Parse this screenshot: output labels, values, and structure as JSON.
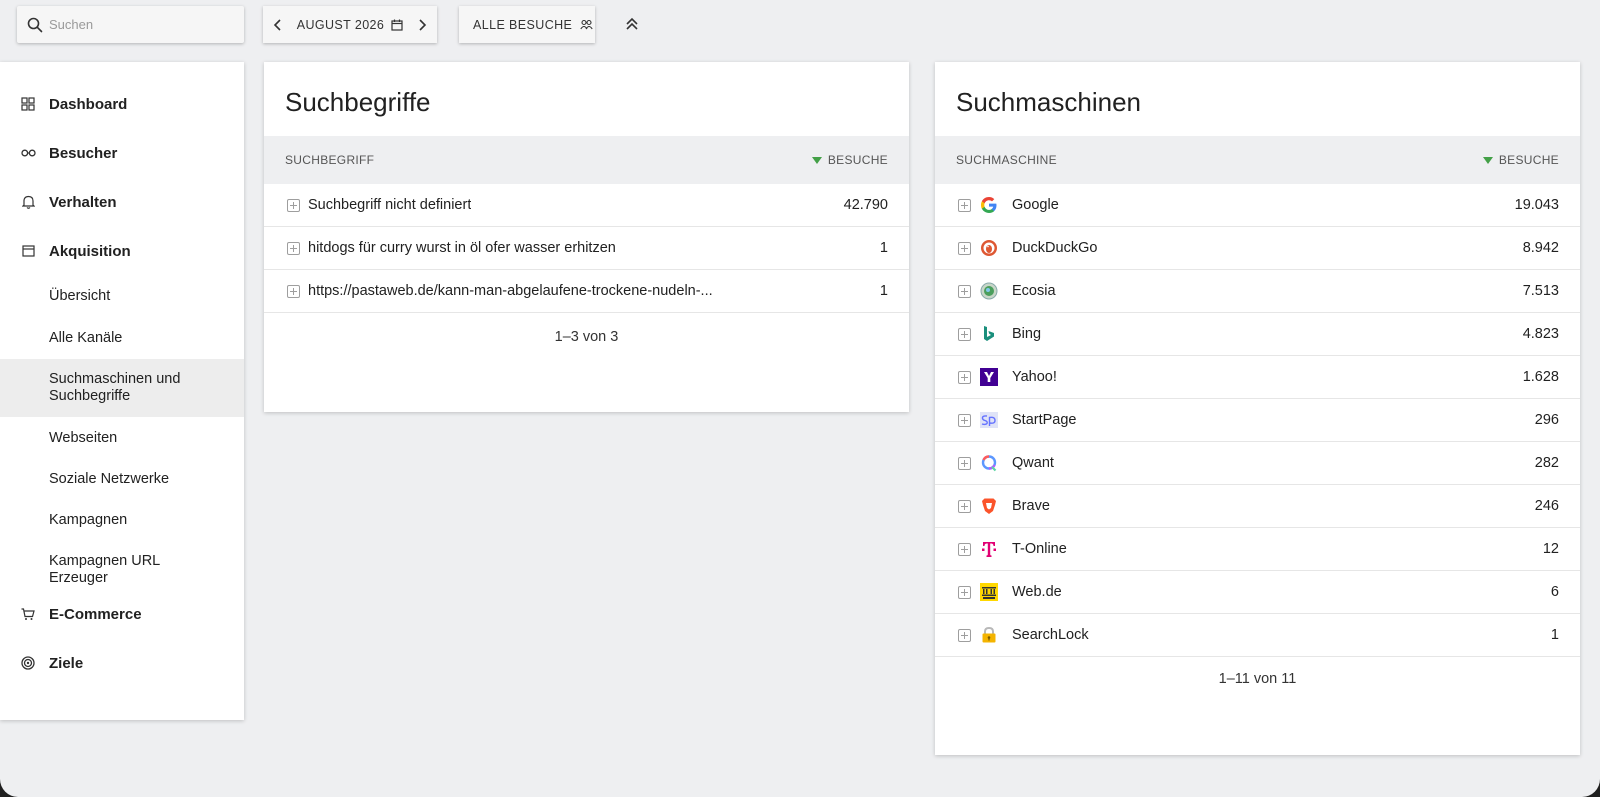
{
  "topbar": {
    "search_placeholder": "Suchen",
    "period_label": "AUGUST 2026",
    "segment_label": "ALLE BESUCHE"
  },
  "sidebar": {
    "categories": [
      {
        "label": "Dashboard",
        "icon": "dashboard-grid-icon"
      },
      {
        "label": "Besucher",
        "icon": "glasses-icon"
      },
      {
        "label": "Verhalten",
        "icon": "bell-icon"
      },
      {
        "label": "Akquisition",
        "icon": "window-icon"
      },
      {
        "label": "E-Commerce",
        "icon": "cart-icon"
      },
      {
        "label": "Ziele",
        "icon": "target-icon"
      }
    ],
    "acquisition_items": [
      {
        "label": "Übersicht"
      },
      {
        "label": "Alle Kanäle"
      },
      {
        "label": "Suchmaschinen und Suchbegriffe",
        "active": true
      },
      {
        "label": "Webseiten"
      },
      {
        "label": "Soziale Netzwerke"
      },
      {
        "label": "Kampagnen"
      },
      {
        "label": "Kampagnen URL Erzeuger"
      }
    ]
  },
  "keywords": {
    "title": "Suchbegriffe",
    "col_label": "SUCHBEGRIFF",
    "col_value": "BESUCHE",
    "rows": [
      {
        "label": "Suchbegriff nicht definiert",
        "value": "42.790"
      },
      {
        "label": "hitdogs für curry wurst in öl ofer wasser erhitzen",
        "value": "1"
      },
      {
        "label": "https://pastaweb.de/kann-man-abgelaufene-trockene-nudeln-...",
        "value": "1"
      }
    ],
    "pager": "1–3 von 3"
  },
  "engines": {
    "title": "Suchmaschinen",
    "col_label": "SUCHMASCHINE",
    "col_value": "BESUCHE",
    "rows": [
      {
        "label": "Google",
        "value": "19.043",
        "icon": "google-logo-icon"
      },
      {
        "label": "DuckDuckGo",
        "value": "8.942",
        "icon": "duckduckgo-logo-icon"
      },
      {
        "label": "Ecosia",
        "value": "7.513",
        "icon": "ecosia-logo-icon"
      },
      {
        "label": "Bing",
        "value": "4.823",
        "icon": "bing-logo-icon"
      },
      {
        "label": "Yahoo!",
        "value": "1.628",
        "icon": "yahoo-logo-icon"
      },
      {
        "label": "StartPage",
        "value": "296",
        "icon": "startpage-logo-icon"
      },
      {
        "label": "Qwant",
        "value": "282",
        "icon": "qwant-logo-icon"
      },
      {
        "label": "Brave",
        "value": "246",
        "icon": "brave-logo-icon"
      },
      {
        "label": "T-Online",
        "value": "12",
        "icon": "t-online-logo-icon"
      },
      {
        "label": "Web.de",
        "value": "6",
        "icon": "webde-logo-icon"
      },
      {
        "label": "SearchLock",
        "value": "1",
        "icon": "lock-logo-icon"
      }
    ],
    "pager": "1–11 von 11"
  },
  "colors": {
    "sort_arrow": "#43a047",
    "header_bg": "#eeeff1",
    "active_nav_bg": "#ededed"
  }
}
